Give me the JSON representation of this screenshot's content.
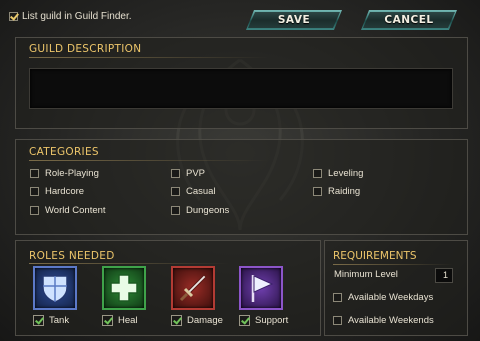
{
  "header": {
    "guild_finder_label": "List guild in Guild Finder.",
    "guild_finder_checked": true,
    "save_label": "SAVE",
    "cancel_label": "CANCEL"
  },
  "description": {
    "title": "GUILD DESCRIPTION",
    "value": ""
  },
  "categories": {
    "title": "CATEGORIES",
    "items": [
      {
        "label": "Role-Playing",
        "checked": false
      },
      {
        "label": "Hardcore",
        "checked": false
      },
      {
        "label": "World Content",
        "checked": false
      },
      {
        "label": "PVP",
        "checked": false
      },
      {
        "label": "Casual",
        "checked": false
      },
      {
        "label": "Dungeons",
        "checked": false
      },
      {
        "label": "Leveling",
        "checked": false
      },
      {
        "label": "Raiding",
        "checked": false
      }
    ]
  },
  "roles": {
    "title": "ROLES NEEDED",
    "items": [
      {
        "label": "Tank",
        "icon": "shield-icon",
        "checked": true
      },
      {
        "label": "Heal",
        "icon": "cross-icon",
        "checked": true
      },
      {
        "label": "Damage",
        "icon": "sword-icon",
        "checked": true
      },
      {
        "label": "Support",
        "icon": "flag-icon",
        "checked": true
      }
    ]
  },
  "requirements": {
    "title": "REQUIREMENTS",
    "min_level_label": "Minimum Level",
    "min_level_value": "1",
    "weekdays_label": "Available Weekdays",
    "weekdays_checked": false,
    "weekends_label": "Available Weekends",
    "weekends_checked": false
  },
  "colors": {
    "section_title": "#ecc56a",
    "button_teal": "#2f6f6b",
    "tank": "#5c79c8",
    "heal": "#3fa34a",
    "damage": "#b33b34",
    "support": "#8c55c9"
  }
}
